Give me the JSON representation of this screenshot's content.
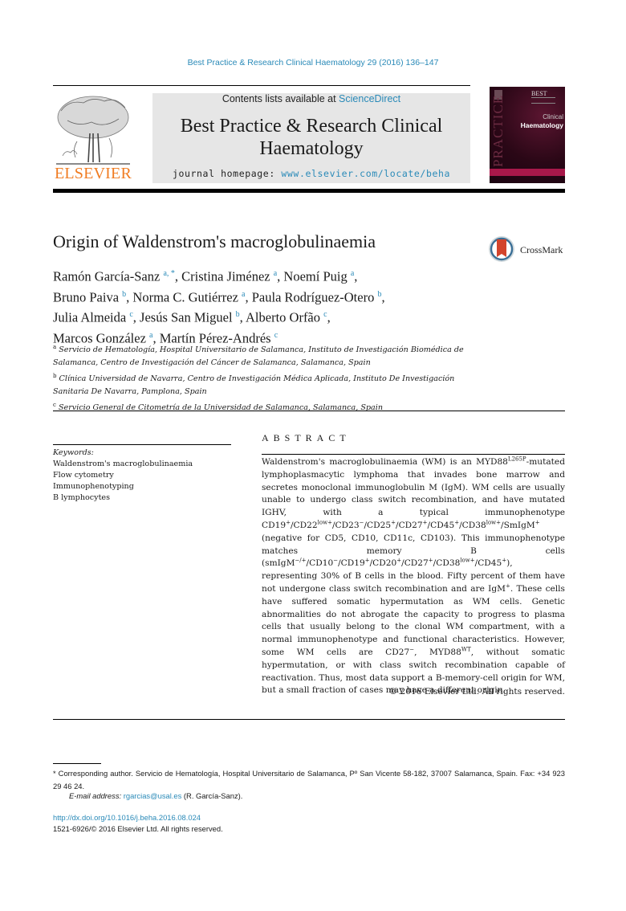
{
  "running_head": "Best Practice & Research Clinical Haematology 29 (2016) 136–147",
  "masthead": {
    "contents_prefix": "Contents lists available at ",
    "contents_link": "ScienceDirect",
    "journal_title": "Best Practice & Research Clinical Haematology",
    "homepage_prefix": "journal homepage: ",
    "homepage_link": "www.elsevier.com/locate/beha",
    "publisher_logo_text": "ELSEVIER"
  },
  "cover": {
    "top_label": "BEST",
    "series_word": "PRACTICE",
    "clinical": "Clinical",
    "haematology": "Haematology"
  },
  "article": {
    "title": "Origin of Waldenstrom's macroglobulinaemia",
    "crossmark_label": "CrossMark",
    "authors": [
      {
        "name": "Ramón García-Sanz",
        "aff": "a, *"
      },
      {
        "name": "Cristina Jiménez",
        "aff": "a"
      },
      {
        "name": "Noemí Puig",
        "aff": "a"
      },
      {
        "name": "Bruno Paiva",
        "aff": "b"
      },
      {
        "name": "Norma C. Gutiérrez",
        "aff": "a"
      },
      {
        "name": "Paula Rodríguez-Otero",
        "aff": "b"
      },
      {
        "name": "Julia Almeida",
        "aff": "c"
      },
      {
        "name": "Jesús San Miguel",
        "aff": "b"
      },
      {
        "name": "Alberto Orfão",
        "aff": "c"
      },
      {
        "name": "Marcos González",
        "aff": "a"
      },
      {
        "name": "Martín Pérez-Andrés",
        "aff": "c"
      }
    ],
    "affiliations": [
      {
        "key": "a",
        "text": "Servicio de Hematología, Hospital Universitario de Salamanca, Instituto de Investigación Biomédica de Salamanca, Centro de Investigación del Cáncer de Salamanca, Salamanca, Spain"
      },
      {
        "key": "b",
        "text": "Clínica Universidad de Navarra, Centro de Investigación Médica Aplicada, Instituto De Investigación Sanitaria De Navarra, Pamplona, Spain"
      },
      {
        "key": "c",
        "text": "Servicio General de Citometría de la Universidad de Salamanca, Salamanca, Spain"
      }
    ]
  },
  "keywords": {
    "label": "Keywords:",
    "items": [
      "Waldenstrom's macroglobulinaemia",
      "Flow cytometry",
      "Immunophenotyping",
      "B lymphocytes"
    ]
  },
  "abstract": {
    "heading": "ABSTRACT",
    "segments": [
      {
        "t": "Waldenstrom's macroglobulinaemia (WM) is an MYD88"
      },
      {
        "sup": "L265P"
      },
      {
        "t": "-mutated lymphoplasmacytic lymphoma that invades bone marrow and secretes monoclonal immunoglobulin M (IgM). WM cells are usually unable to undergo class switch recombination, and have mutated IGHV, with a typical immunophenotype CD19"
      },
      {
        "sup": "+"
      },
      {
        "t": "/CD22"
      },
      {
        "sup": "low+"
      },
      {
        "t": "/CD23"
      },
      {
        "sup": "−"
      },
      {
        "t": "/CD25"
      },
      {
        "sup": "+"
      },
      {
        "t": "/CD27"
      },
      {
        "sup": "+"
      },
      {
        "t": "/CD45"
      },
      {
        "sup": "+"
      },
      {
        "t": "/CD38"
      },
      {
        "sup": "low+"
      },
      {
        "t": "/SmIgM"
      },
      {
        "sup": "+"
      },
      {
        "t": " (negative for CD5, CD10, CD11c, CD103). This immunophenotype matches memory B cells (smIgM"
      },
      {
        "sup": "−/+"
      },
      {
        "t": "/CD10"
      },
      {
        "sup": "−"
      },
      {
        "t": "/CD19"
      },
      {
        "sup": "+"
      },
      {
        "t": "/CD20"
      },
      {
        "sup": "+"
      },
      {
        "t": "/CD27"
      },
      {
        "sup": "+"
      },
      {
        "t": "/CD38"
      },
      {
        "sup": "low+"
      },
      {
        "t": "/CD45"
      },
      {
        "sup": "+"
      },
      {
        "t": "), representing 30% of B cells in the blood. Fifty percent of them have not undergone class switch recombination and are IgM"
      },
      {
        "sup": "+"
      },
      {
        "t": ". These cells have suffered somatic hypermutation as WM cells. Genetic abnormalities do not abrogate the capacity to progress to plasma cells that usually belong to the clonal WM compartment, with a normal immunophenotype and functional characteristics. However, some WM cells are CD27"
      },
      {
        "sup": "−"
      },
      {
        "t": ", MYD88"
      },
      {
        "sup": "WT"
      },
      {
        "t": ", without somatic hypermutation, or with class switch recombination capable of reactivation. Thus, most data support a B-memory-cell origin for WM, but a small fraction of cases may have a different origin."
      }
    ],
    "copyright": "© 2016 Elsevier Ltd. All rights reserved."
  },
  "footnotes": {
    "corresponding": "* Corresponding author. Servicio de Hematología, Hospital Universitario de Salamanca, Pº San Vicente 58-182, 37007 Salamanca, Spain. Fax: +34 923 29 46 24.",
    "email_label": "E-mail address:",
    "email": "rgarcias@usal.es",
    "email_suffix": " (R. García-Sanz).",
    "doi": "http://dx.doi.org/10.1016/j.beha.2016.08.024",
    "issn": "1521-6926/© 2016 Elsevier Ltd. All rights reserved."
  },
  "colors": {
    "link": "#2a8ab8",
    "elsevier_orange": "#f07c22",
    "masthead_bg": "#e6e6e6",
    "cover_band": "#a8184a"
  }
}
